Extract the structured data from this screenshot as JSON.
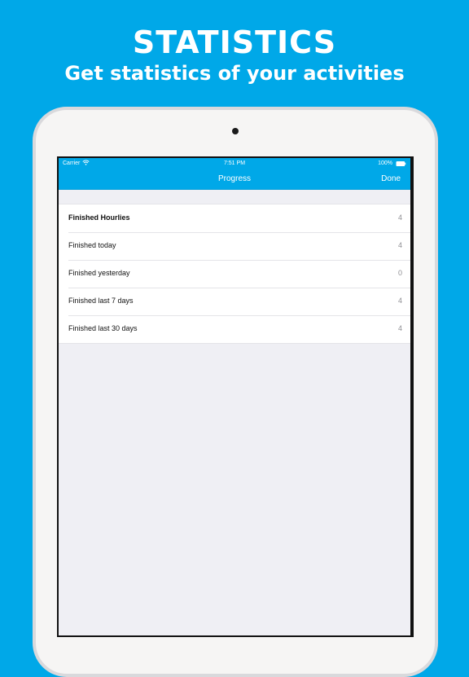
{
  "banner": {
    "headline": "STATISTICS",
    "subheadline": "Get statistics of your activities"
  },
  "status_bar": {
    "carrier": "Carrier",
    "time": "7:51 PM",
    "battery": "100%",
    "icons": [
      "wifi-icon",
      "battery-icon"
    ]
  },
  "nav": {
    "title": "Progress",
    "done_label": "Done"
  },
  "stats": {
    "rows": [
      {
        "label": "Finished Hourlies",
        "value": "4"
      },
      {
        "label": "Finished today",
        "value": "4"
      },
      {
        "label": "Finished yesterday",
        "value": "0"
      },
      {
        "label": "Finished last 7 days",
        "value": "4"
      },
      {
        "label": "Finished last 30 days",
        "value": "4"
      }
    ]
  },
  "colors": {
    "brand_blue": "#00a8e8",
    "background_gray": "#efeff4",
    "value_gray": "#8e8e93"
  }
}
